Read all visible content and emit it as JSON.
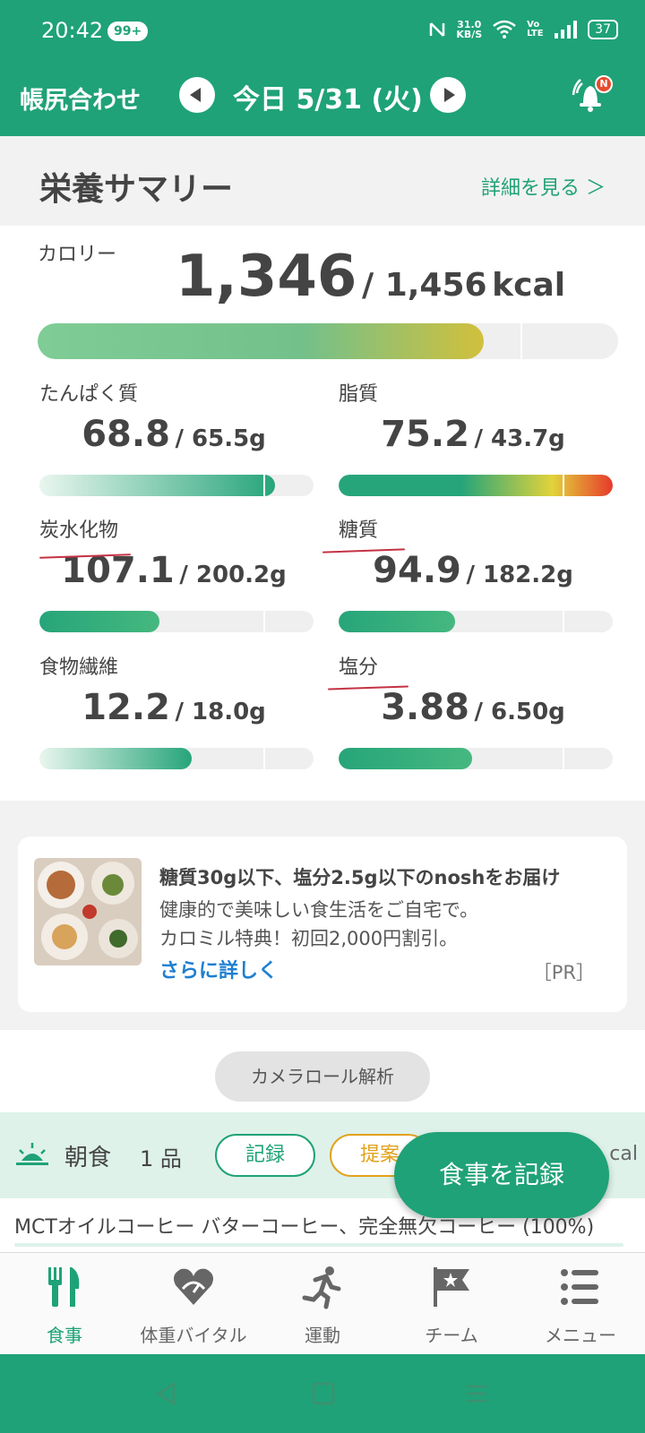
{
  "status_bar": {
    "time": "20:42",
    "notif_badge": "99+",
    "net_speed_value": "31.0",
    "net_speed_unit": "KB/S",
    "volte": "Vo LTE",
    "battery": "37"
  },
  "header": {
    "title": "帳尻合わせ",
    "date": "今日 5/31 (火)",
    "bell_badge": "N"
  },
  "summary": {
    "title": "栄養サマリー",
    "detail_link": "詳細を見る ＞"
  },
  "calorie": {
    "label": "カロリー",
    "value": "1,346",
    "target": "/ 1,456",
    "unit": "kcal",
    "fraction": 0.924
  },
  "nutrients": [
    {
      "label": "たんぱく質",
      "value": "68.8",
      "target": "/ 65.5g",
      "fraction": 1.05
    },
    {
      "label": "脂質",
      "value": "75.2",
      "target": "/ 43.7g",
      "fraction": 1.72
    },
    {
      "label": "炭水化物",
      "value": "107.1",
      "target": "/ 200.2g",
      "fraction": 0.535
    },
    {
      "label": "糖質",
      "value": "94.9",
      "target": "/ 182.2g",
      "fraction": 0.521
    },
    {
      "label": "食物繊維",
      "value": "12.2",
      "target": "/ 18.0g",
      "fraction": 0.678
    },
    {
      "label": "塩分",
      "value": "3.88",
      "target": "/ 6.50g",
      "fraction": 0.597
    }
  ],
  "ad": {
    "title": "糖質30g以下、塩分2.5g以下のnoshをお届け",
    "line1": "健康的で美味しい食生活をご自宅で。",
    "line2": "カロミル特典！初回2,000円割引。",
    "link": "さらに詳しく",
    "pr": "［PR］"
  },
  "camera_button": "カメラロール解析",
  "meal": {
    "name": "朝食",
    "count": "1 品",
    "record_label": "記録",
    "suggest_label": "提案",
    "cal_suffix": "cal",
    "items": [
      "MCTオイルコーヒー バターコーヒー、完全無欠コーヒー (100%)"
    ]
  },
  "fab_label": "食事を記録",
  "tabs": [
    {
      "label": "食事",
      "icon": "fork-knife-icon"
    },
    {
      "label": "体重バイタル",
      "icon": "heart-gauge-icon"
    },
    {
      "label": "運動",
      "icon": "runner-icon"
    },
    {
      "label": "チーム",
      "icon": "flag-star-icon"
    },
    {
      "label": "メニュー",
      "icon": "menu-list-icon"
    }
  ],
  "colors": {
    "brand": "#1fa277",
    "over": "#e73a2b",
    "link": "#1e7fd1",
    "suggest": "#e2a21b"
  }
}
